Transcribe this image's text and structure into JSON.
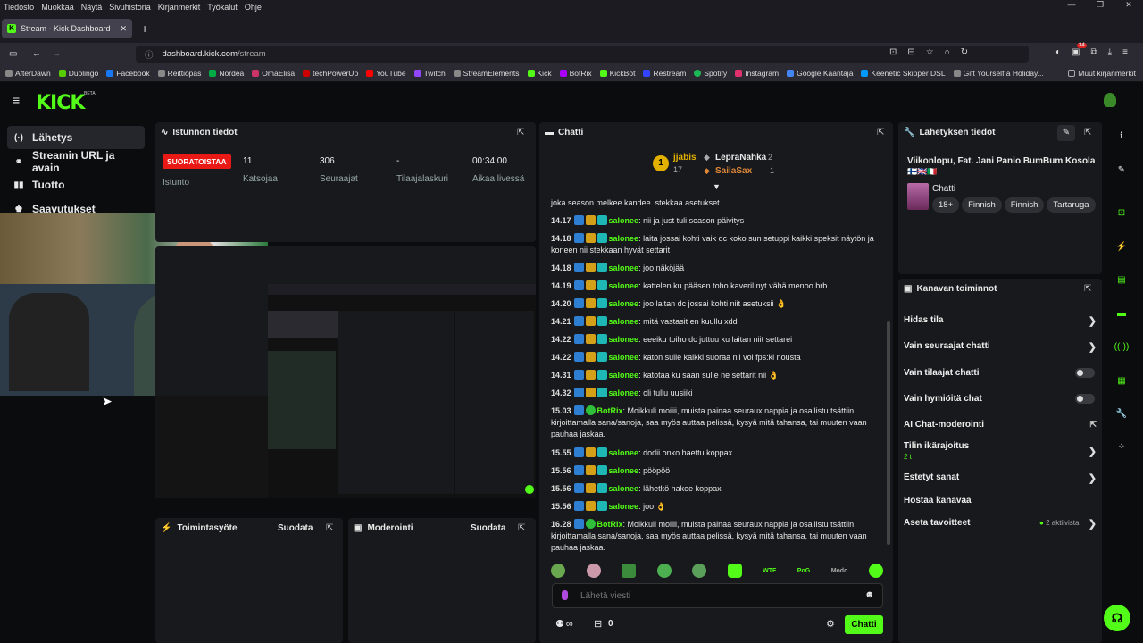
{
  "browser": {
    "menu": [
      "Tiedosto",
      "Muokkaa",
      "Näytä",
      "Sivuhistoria",
      "Kirjanmerkit",
      "Työkalut",
      "Ohje"
    ],
    "tab_title": "Stream - Kick Dashboard",
    "url_host": "dashboard.kick.com",
    "url_path": "/stream",
    "badge_count": "34",
    "bookmarks": [
      "AfterDawn",
      "Duolingo",
      "Facebook",
      "Reittiopas",
      "Nordea",
      "OmaElisa",
      "techPowerUp",
      "YouTube",
      "Twitch",
      "StreamElements",
      "Kick",
      "BotRix",
      "KickBot",
      "Restream",
      "Spotify",
      "Instagram",
      "Google Kääntäjä",
      "Keenetic Skipper DSL",
      "Gift Yourself a Holiday..."
    ],
    "other_bookmarks": "Muut kirjanmerkit"
  },
  "kick": {
    "logo": "KICK",
    "beta": "BETA"
  },
  "sidebar": {
    "items": [
      {
        "label": "Lähetys",
        "icon": "(·)"
      },
      {
        "label": "Streamin URL ja avain",
        "icon": "⚭"
      },
      {
        "label": "Tuotto",
        "icon": "▮▮"
      },
      {
        "label": "Saavutukset",
        "icon": "♚"
      }
    ]
  },
  "session": {
    "title": "Istunnon tiedot",
    "status": "SUORATOISTAA",
    "status_label": "Istunto",
    "viewers": "11",
    "viewers_label": "Katsojaa",
    "followers": "306",
    "followers_label": "Seuraajat",
    "subs": "-",
    "subs_label": "Tilaajalaskuri",
    "time": "00:34:00",
    "time_label": "Aikaa livessä"
  },
  "activity": {
    "title": "Toimintasyöte",
    "filter": "Suodata"
  },
  "moderation": {
    "title": "Moderointi",
    "filter": "Suodata"
  },
  "chat": {
    "title": "Chatti",
    "lb": [
      {
        "rank": "1",
        "name": "jjabis",
        "count": "17"
      },
      {
        "name": "LepraNahka",
        "count": "2"
      },
      {
        "name": "SailaSax",
        "count": "1"
      }
    ],
    "partial": "joka season melkee kandee. stekkaa asetukset",
    "messages": [
      {
        "t": "14.17",
        "u": "salonee",
        "m": "nii ja just tuli season päivitys"
      },
      {
        "t": "14.18",
        "u": "salonee",
        "m": "laita jossai kohti vaik dc koko sun setuppi kaikki speksit näytön ja koneen nii stekkaan hyvät settarit"
      },
      {
        "t": "14.18",
        "u": "salonee",
        "m": "joo näköjää"
      },
      {
        "t": "14.19",
        "u": "salonee",
        "m": "kattelen ku pääsen toho kaveril nyt vähä menoo brb"
      },
      {
        "t": "14.20",
        "u": "salonee",
        "m": "joo laitan dc jossai kohti niit asetuksii 👌"
      },
      {
        "t": "14.21",
        "u": "salonee",
        "m": "mitä vastasit en kuullu xdd"
      },
      {
        "t": "14.22",
        "u": "salonee",
        "m": "eeeiku toiho dc juttuu ku laitan niit settarei"
      },
      {
        "t": "14.22",
        "u": "salonee",
        "m": "katon sulle kaikki suoraa nii voi fps:ki nousta"
      },
      {
        "t": "14.31",
        "u": "salonee",
        "m": "katotaa ku saan sulle ne settarit nii 👌"
      },
      {
        "t": "14.32",
        "u": "salonee",
        "m": "oli tullu uusiiki"
      },
      {
        "t": "15.03",
        "u": "BotRix",
        "m": "Moikkuli moiiii, muista painaa seuraux nappia ja osallistu tsättiin kirjoittamalla sana/sanoja, saa myös auttaa pelissä, kysyä mitä tahansa, tai muuten vaan pauhaa jaskaa."
      },
      {
        "t": "15.55",
        "u": "salonee",
        "m": "dodii onko haettu koppax"
      },
      {
        "t": "15.56",
        "u": "salonee",
        "m": "pööpöö"
      },
      {
        "t": "15.56",
        "u": "salonee",
        "m": "lähetkö hakee koppax"
      },
      {
        "t": "15.56",
        "u": "salonee",
        "m": "joo 👌"
      },
      {
        "t": "16.28",
        "u": "BotRix",
        "m": "Moikkuli moiiii, muista painaa seuraux nappia ja osallistu tsättiin kirjoittamalla sana/sanoja, saa myös auttaa pelissä, kysyä mitä tahansa, tai muuten vaan pauhaa jaskaa."
      }
    ],
    "emotes": [
      "WTF",
      "PoG",
      "Modo"
    ],
    "placeholder": "Lähetä viesti",
    "infinity": "∞",
    "count": "0",
    "send": "Chatti"
  },
  "broadcast": {
    "title": "Lähetyksen tiedot",
    "stream_title": "Viikonlopu, Fat. Jani Panio BumBum Kosola",
    "flags": "🇫🇮🇬🇧🇮🇹",
    "category": "Chatti",
    "tags": [
      "18+",
      "Finnish",
      "Finnish",
      "Tartaruga"
    ]
  },
  "channel": {
    "title": "Kanavan toiminnot",
    "items": [
      {
        "label": "Hidas tila"
      },
      {
        "label": "Vain seuraajat chatti"
      },
      {
        "label": "Vain tilaajat chatti"
      },
      {
        "label": "Vain hymiöitä chat"
      },
      {
        "label": "AI Chat-moderointi"
      },
      {
        "label": "Tilin ikärajoitus",
        "sub": "2 t"
      },
      {
        "label": "Estetyt sanat"
      },
      {
        "label": "Hostaa kanavaa"
      },
      {
        "label": "Aseta tavoitteet",
        "status": "2 aktiivista"
      }
    ]
  },
  "colors": {
    "accent": "#53fc18",
    "live": "#e91916",
    "panel": "#18191c"
  }
}
